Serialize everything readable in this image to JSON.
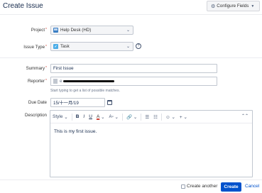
{
  "dialog": {
    "title": "Create Issue",
    "configure_fields_label": "Configure Fields"
  },
  "fields": {
    "project": {
      "label": "Project",
      "value": "Help Desk (HD)"
    },
    "issue_type": {
      "label": "Issue Type",
      "value": "Task",
      "help_glyph": "?"
    },
    "summary": {
      "label": "Summary",
      "value": "First Issue"
    },
    "reporter": {
      "label": "Reporter",
      "value_prefix": "e",
      "hint": "Start typing to get a list of possible matches."
    },
    "due_date": {
      "label": "Due Date",
      "value": "15/十一月/19"
    },
    "description": {
      "label": "Description",
      "toolbar": {
        "style_label": "Style",
        "bold": "B",
        "italic": "I",
        "underline": "U",
        "text_color": "A"
      },
      "content": "This is my first issue."
    }
  },
  "footer": {
    "create_another_label": "Create another",
    "create_label": "Create",
    "cancel_label": "Cancel"
  },
  "colors": {
    "primary": "#0052cc",
    "required": "#d04437"
  },
  "icons": [
    "gear-icon",
    "chevron-down-icon",
    "help-icon",
    "project-icon",
    "task-icon",
    "avatar-icon",
    "calendar-icon",
    "link-icon",
    "bullet-list-icon",
    "numbered-list-icon",
    "emoji-icon",
    "plus-icon",
    "collapse-icon"
  ]
}
